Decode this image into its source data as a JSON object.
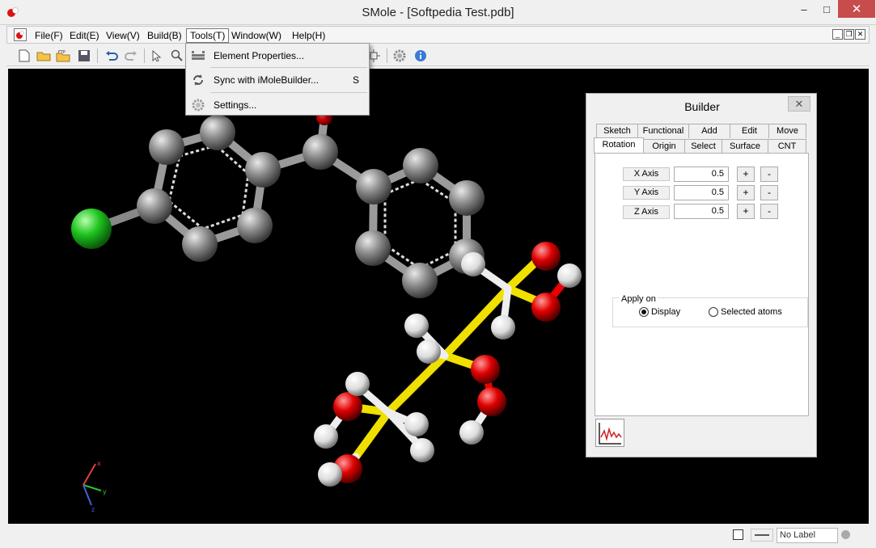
{
  "window": {
    "title": "SMole - [Softpedia Test.pdb]",
    "close_glyph": "✕",
    "min_glyph": "–",
    "max_glyph": "□"
  },
  "menubar": {
    "items": [
      "File(F)",
      "Edit(E)",
      "View(V)",
      "Build(B)",
      "Tools(T)",
      "Window(W)",
      "Help(H)"
    ],
    "active": "Tools(T)"
  },
  "tools_menu": {
    "items": [
      {
        "label": "Element Properties...",
        "icon": "periodic-table-icon",
        "shortcut": ""
      },
      {
        "label": "Sync with iMoleBuilder...",
        "icon": "sync-icon",
        "shortcut": "S"
      },
      {
        "label": "Settings...",
        "icon": "gear-icon",
        "shortcut": ""
      }
    ]
  },
  "builder": {
    "title": "Builder",
    "tabs_row1": [
      "Sketch",
      "Functional",
      "Add",
      "Edit",
      "Move"
    ],
    "tabs_row2": [
      "Rotation",
      "Origin",
      "Select",
      "Surface",
      "CNT"
    ],
    "active_tab": "Rotation",
    "axes": [
      {
        "label": "X Axis",
        "value": "0.5"
      },
      {
        "label": "Y Axis",
        "value": "0.5"
      },
      {
        "label": "Z Axis",
        "value": "0.5"
      }
    ],
    "plus": "+",
    "minus": "-",
    "apply_on": {
      "title": "Apply on",
      "options": [
        "Display",
        "Selected atoms"
      ],
      "selected": "Display"
    }
  },
  "statusbar": {
    "label": "No Label"
  },
  "colors": {
    "carbon": "#888888",
    "chlorine": "#1fc41f",
    "oxygen": "#e00000",
    "hydrogen": "#ffffff",
    "bond_yellow": "#f0e000",
    "close_red": "#c74c4c"
  },
  "axis_labels": {
    "x": "x",
    "y": "y",
    "z": "z"
  }
}
